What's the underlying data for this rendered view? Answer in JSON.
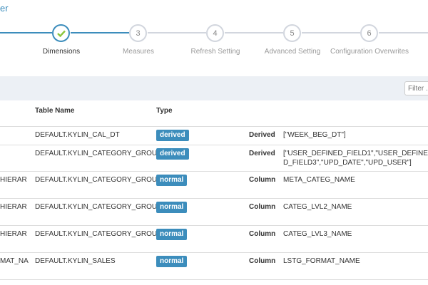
{
  "header": {
    "link": "er"
  },
  "steps": [
    {
      "number": "",
      "label": "Dimensions",
      "done": true
    },
    {
      "number": "3",
      "label": "Measures",
      "done": false
    },
    {
      "number": "4",
      "label": "Refresh Setting",
      "done": false
    },
    {
      "number": "5",
      "label": "Advanced Setting",
      "done": false
    },
    {
      "number": "6",
      "label": "Configuration Overwrites",
      "done": false
    }
  ],
  "filter": {
    "placeholder": "Filter ..."
  },
  "table": {
    "headers": {
      "table_name": "Table Name",
      "type": "Type"
    },
    "rows": [
      {
        "column": "",
        "table": "DEFAULT.KYLIN_CAL_DT",
        "type": "derived",
        "kind": "Derived",
        "value": "[\"WEEK_BEG_DT\"]"
      },
      {
        "column": "",
        "table": "DEFAULT.KYLIN_CATEGORY_GROUPINGS",
        "type": "derived",
        "kind": "Derived",
        "value": "[\"USER_DEFINED_FIELD1\",\"USER_DEFINED_FIELD3\",\"UPD_DATE\",\"UPD_USER\"]"
      },
      {
        "column": "HIERAR",
        "table": "DEFAULT.KYLIN_CATEGORY_GROUPINGS",
        "type": "normal",
        "kind": "Column",
        "value": "META_CATEG_NAME"
      },
      {
        "column": "HIERAR",
        "table": "DEFAULT.KYLIN_CATEGORY_GROUPINGS",
        "type": "normal",
        "kind": "Column",
        "value": "CATEG_LVL2_NAME"
      },
      {
        "column": "HIERAR",
        "table": "DEFAULT.KYLIN_CATEGORY_GROUPINGS",
        "type": "normal",
        "kind": "Column",
        "value": "CATEG_LVL3_NAME"
      },
      {
        "column": "MAT_NA",
        "table": "DEFAULT.KYLIN_SALES",
        "type": "normal",
        "kind": "Column",
        "value": "LSTG_FORMAT_NAME"
      }
    ]
  },
  "colors": {
    "accent": "#3c8dbc",
    "derived_badge": "#3c8dbc",
    "normal_badge": "#3c8dbc",
    "check": "#8cc63e"
  }
}
